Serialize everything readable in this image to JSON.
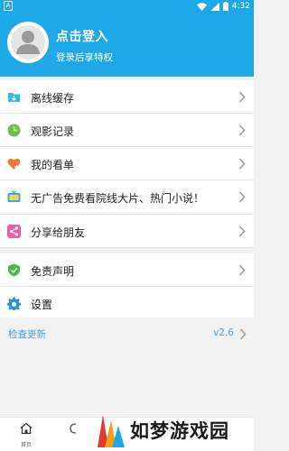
{
  "status_bar": {
    "left_glyph": "A",
    "time": "4:32"
  },
  "header": {
    "title": "点击登入",
    "subtitle": "登录后享特权",
    "bg_color": "#1fa8e8"
  },
  "menu": {
    "items": [
      {
        "label": "离线缓存",
        "icon": "download-folder-icon"
      },
      {
        "label": "观影记录",
        "icon": "clock-icon"
      },
      {
        "label": "我的看单",
        "icon": "heart-plus-icon"
      },
      {
        "label": "无广告免费看院线大片、热门小说！",
        "icon": "tv-icon"
      },
      {
        "label": "分享给朋友",
        "icon": "share-icon"
      },
      {
        "label": "免责声明",
        "icon": "shield-icon"
      },
      {
        "label": "设置",
        "icon": "gear-icon"
      }
    ]
  },
  "update": {
    "label": "检查更新",
    "version": "v2.6"
  },
  "tabbar": {
    "tabs": [
      {
        "label": "首页",
        "icon": "home-icon"
      }
    ]
  },
  "watermark": {
    "text": "如梦游戏园"
  }
}
